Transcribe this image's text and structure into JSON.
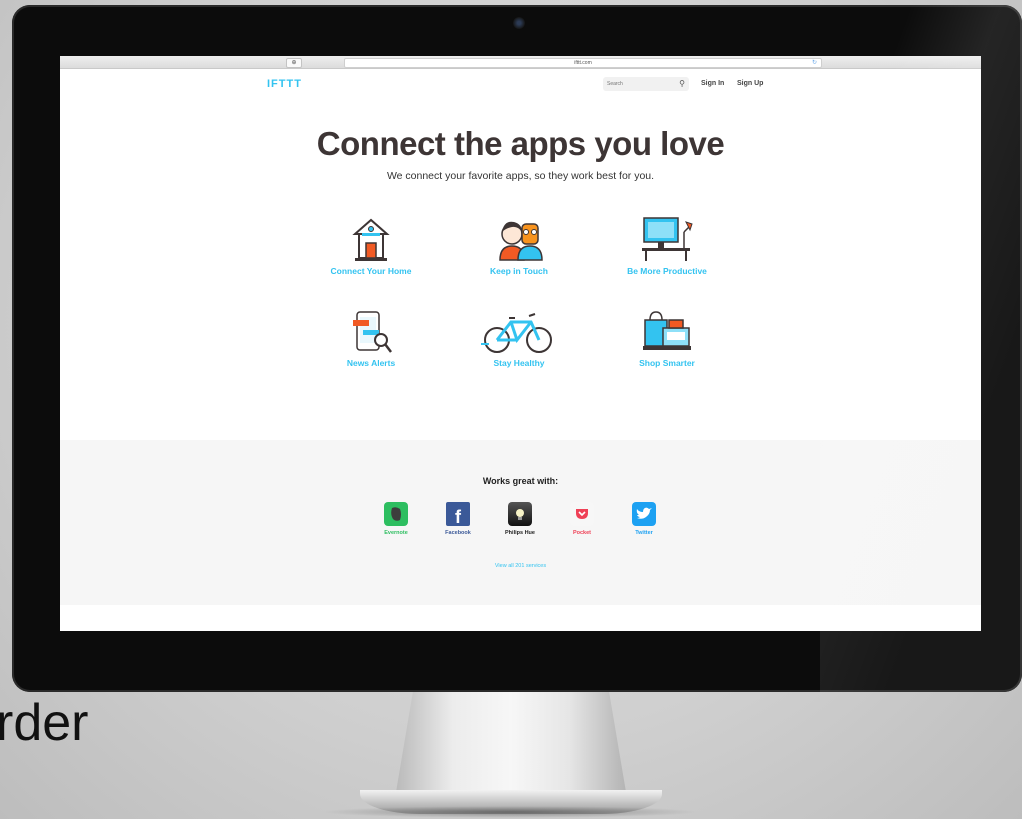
{
  "background_text": "rder",
  "browser": {
    "url": "ifttt.com",
    "reload_glyph": "↻"
  },
  "header": {
    "logo": "IFTTT",
    "search_placeholder": "Search",
    "sign_in": "Sign In",
    "sign_up": "Sign Up"
  },
  "hero": {
    "title": "Connect the apps you love",
    "subtitle": "We connect your favorite apps, so they work best for you."
  },
  "categories": [
    {
      "label": "Connect Your Home",
      "icon": "house-icon"
    },
    {
      "label": "Keep in Touch",
      "icon": "people-icon"
    },
    {
      "label": "Be More Productive",
      "icon": "desk-icon"
    },
    {
      "label": "News Alerts",
      "icon": "phone-news-icon"
    },
    {
      "label": "Stay Healthy",
      "icon": "bicycle-icon"
    },
    {
      "label": "Shop Smarter",
      "icon": "shopping-icon"
    }
  ],
  "works_with": {
    "title": "Works great with:",
    "services": [
      {
        "name": "Evernote",
        "color": "#2dbe60"
      },
      {
        "name": "Facebook",
        "color": "#3b5998"
      },
      {
        "name": "Philips Hue",
        "color": "#222222"
      },
      {
        "name": "Pocket",
        "color": "#ef4056"
      },
      {
        "name": "Twitter",
        "color": "#1da1f2"
      }
    ],
    "view_all": "View all 201 services"
  },
  "colors": {
    "accent": "#33c3f0",
    "title": "#3d3535"
  }
}
